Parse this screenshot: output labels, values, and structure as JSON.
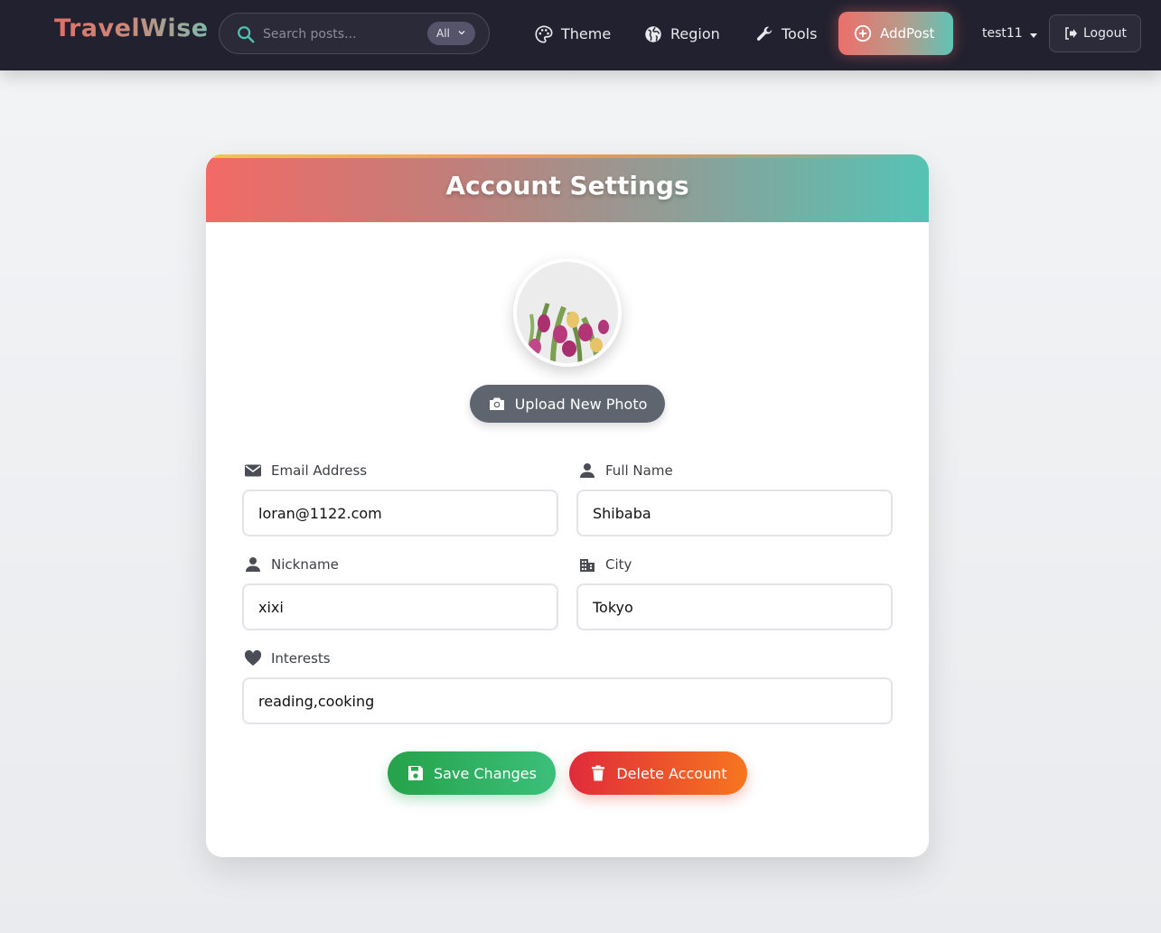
{
  "nav": {
    "logo": "TravelWise",
    "search_placeholder": "Search posts...",
    "filter_label": "All",
    "theme_label": "Theme",
    "region_label": "Region",
    "tools_label": "Tools",
    "addpost_label": "AddPost",
    "username": "test11",
    "logout_label": "Logout"
  },
  "card": {
    "title": "Account Settings",
    "upload_label": "Upload New Photo",
    "fields": {
      "email": {
        "label": "Email Address",
        "value": "loran@1122.com"
      },
      "fullname": {
        "label": "Full Name",
        "value": "Shibaba"
      },
      "nickname": {
        "label": "Nickname",
        "value": "xixi"
      },
      "city": {
        "label": "City",
        "value": "Tokyo"
      },
      "interests": {
        "label": "Interests",
        "value": "reading,cooking"
      }
    },
    "save_label": "Save Changes",
    "delete_label": "Delete Account"
  },
  "icons": {
    "search": "search-icon",
    "filter_chevron": "chevron-down-icon",
    "theme": "palette-icon",
    "region": "globe-icon",
    "tools": "wrench-icon",
    "addpost": "plus-circle-icon",
    "logout": "logout-icon",
    "camera": "camera-icon",
    "email": "envelope-icon",
    "fullname": "person-icon",
    "nickname": "person-icon",
    "city": "building-icon",
    "interests": "heart-icon",
    "save": "floppy-disk-icon",
    "delete": "trash-icon"
  },
  "colors": {
    "navbar_bg": "#22212f",
    "header_gradient_start": "#f26a66",
    "header_gradient_end": "#55c3b5",
    "save_green": "#25a24a",
    "delete_red": "#e02b3a",
    "delete_orange": "#f7761f",
    "upload_gray": "#5f656f"
  }
}
